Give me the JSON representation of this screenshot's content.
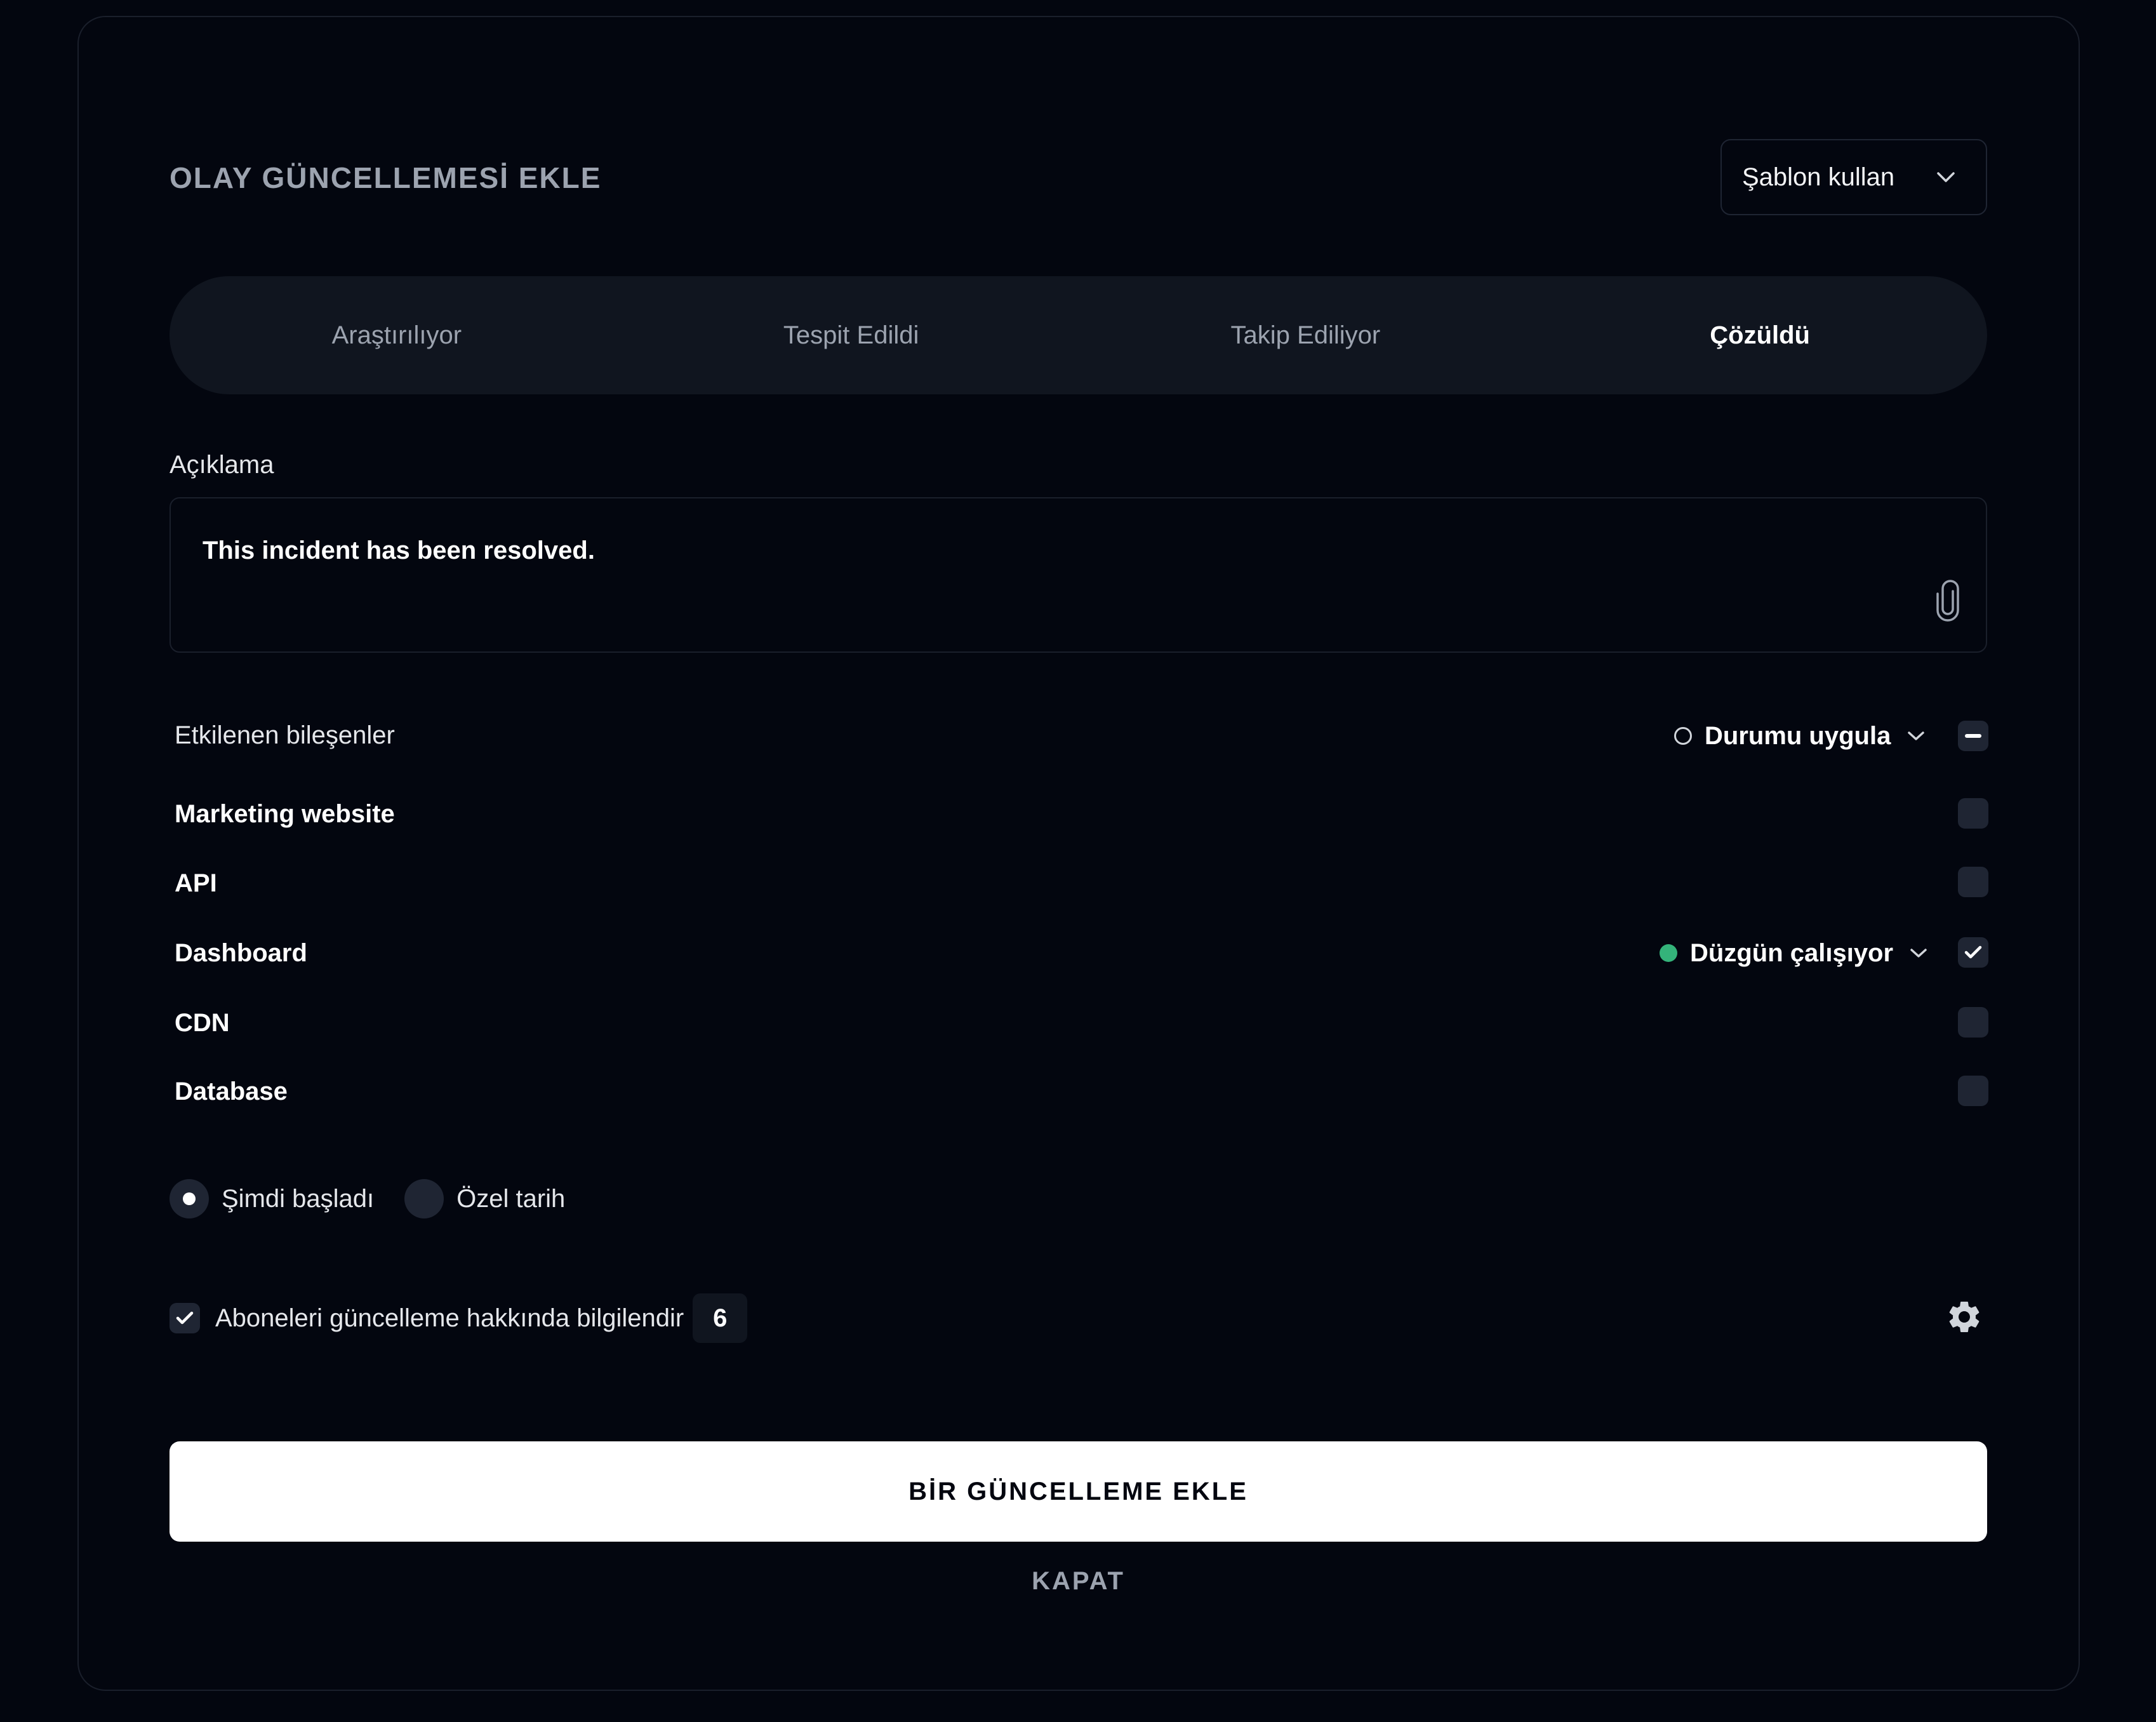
{
  "modal": {
    "title": "OLAY GÜNCELLEMESİ EKLE",
    "template_select": {
      "label": "Şablon kullan",
      "icon": "chevron-down-icon"
    },
    "status_tabs": [
      {
        "label": "Araştırılıyor",
        "active": false
      },
      {
        "label": "Tespit Edildi",
        "active": false
      },
      {
        "label": "Takip Ediliyor",
        "active": false
      },
      {
        "label": "Çözüldü",
        "active": true
      }
    ],
    "description": {
      "label": "Açıklama",
      "value": "This incident has been resolved.",
      "attach_icon": "paperclip-icon"
    },
    "components": {
      "header_label": "Etkilenen bileşenler",
      "apply_status_label": "Durumu uygula",
      "select_all_state": "indeterminate",
      "items": [
        {
          "name": "Marketing website",
          "checked": false,
          "status": null
        },
        {
          "name": "API",
          "checked": false,
          "status": null
        },
        {
          "name": "Dashboard",
          "checked": true,
          "status": "Düzgün çalışıyor",
          "status_color": "#34b37a"
        },
        {
          "name": "CDN",
          "checked": false,
          "status": null
        },
        {
          "name": "Database",
          "checked": false,
          "status": null
        }
      ]
    },
    "start_time": {
      "options": [
        {
          "label": "Şimdi başladı",
          "selected": true
        },
        {
          "label": "Özel tarih",
          "selected": false
        }
      ]
    },
    "notify": {
      "label": "Aboneleri güncelleme hakkında bilgilendir",
      "checked": true,
      "count": "6",
      "settings_icon": "gear-icon"
    },
    "primary_button": "BİR GÜNCELLEME EKLE",
    "close_button": "KAPAT"
  },
  "colors": {
    "background": "#03060f",
    "surface": "#10151f",
    "control": "#1f2533",
    "operational_green": "#34b37a",
    "primary_button_bg": "#ffffff"
  }
}
